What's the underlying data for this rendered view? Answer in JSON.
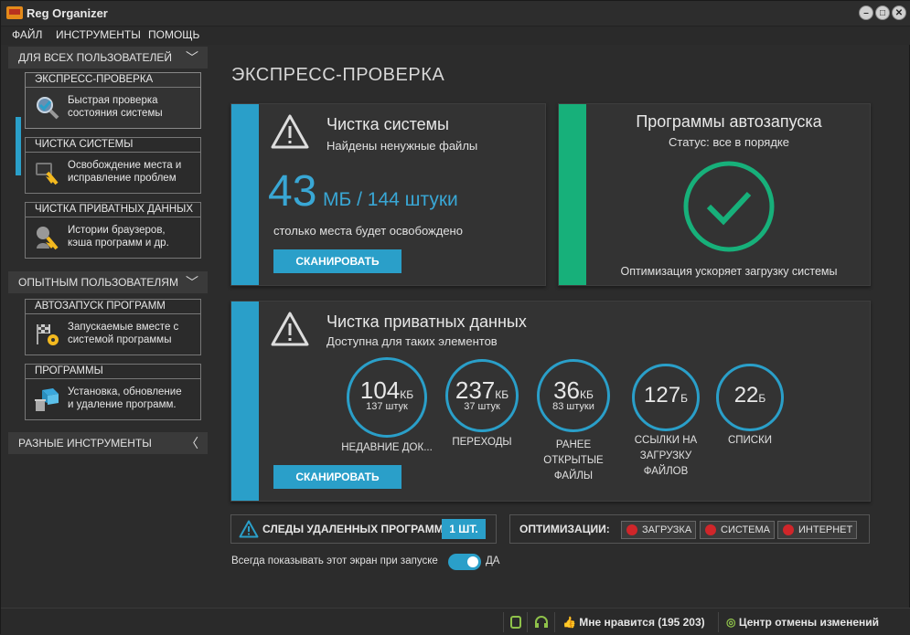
{
  "window": {
    "title": "Reg Organizer"
  },
  "menu": [
    "ФАЙЛ",
    "ИНСТРУМЕНТЫ",
    "ПОМОЩЬ"
  ],
  "sidebar": {
    "group1": "ДЛЯ ВСЕХ ПОЛЬЗОВАТЕЛЕЙ",
    "group2": "ОПЫТНЫМ ПОЛЬЗОВАТЕЛЯМ",
    "group3": "РАЗНЫЕ ИНСТРУМЕНТЫ",
    "items": [
      {
        "title": "ЭКСПРЕСС-ПРОВЕРКА",
        "desc1": "Быстрая проверка",
        "desc2": "состояния системы"
      },
      {
        "title": "ЧИСТКА СИСТЕМЫ",
        "desc1": "Освобождение места и",
        "desc2": "исправление проблем"
      },
      {
        "title": "ЧИСТКА ПРИВАТНЫХ ДАННЫХ",
        "desc1": "Истории браузеров,",
        "desc2": "кэша программ и др."
      },
      {
        "title": "АВТОЗАПУСК ПРОГРАММ",
        "desc1": "Запускаемые вместе с",
        "desc2": "системой программы"
      },
      {
        "title": "ПРОГРАММЫ",
        "desc1": "Установка, обновление",
        "desc2": "и удаление программ."
      }
    ]
  },
  "main": {
    "title": "ЭКСПРЕСС-ПРОВЕРКА",
    "system_clean": {
      "title": "Чистка системы",
      "subtitle": "Найдены ненужные файлы",
      "size": "43",
      "details": "МБ / 144 штуки",
      "caption": "столько места будет освобождено",
      "button": "СКАНИРОВАТЬ"
    },
    "autorun": {
      "title": "Программы автозапуска",
      "status": "Статус: все в порядке",
      "note": "Оптимизация ускоряет загрузку системы"
    },
    "private": {
      "title": "Чистка приватных данных",
      "subtitle": "Доступна для таких элементов",
      "button": "СКАНИРОВАТЬ",
      "items": [
        {
          "value": "104",
          "unit": "КБ",
          "sub": "137 штук",
          "label": "НЕДАВНИЕ ДОК..."
        },
        {
          "value": "237",
          "unit": "КБ",
          "sub": "37 штук",
          "label": "ПЕРЕХОДЫ"
        },
        {
          "value": "36",
          "unit": "КБ",
          "sub": "83 штуки",
          "label": "РАНЕЕ ОТКРЫТЫЕ ФАЙЛЫ"
        },
        {
          "value": "127",
          "unit": "Б",
          "sub": "",
          "label": "ССЫЛКИ НА ЗАГРУЗКУ ФАЙЛОВ"
        },
        {
          "value": "22",
          "unit": "Б",
          "sub": "",
          "label": "СПИСКИ"
        }
      ]
    },
    "traces": {
      "label": "СЛЕДЫ УДАЛЕННЫХ ПРОГРАММ",
      "count": "1 ШТ."
    },
    "optim": {
      "label": "ОПТИМИЗАЦИИ:",
      "b1": "ЗАГРУЗКА",
      "b2": "СИСТЕМА",
      "b3": "ИНТЕРНЕТ"
    },
    "toggle": {
      "label": "Всегда показывать этот экран при запуске",
      "value": "ДА"
    }
  },
  "status": {
    "likes": "Мне нравится (195 203)",
    "undo": "Центр отмены изменений"
  },
  "colors": {
    "accent": "#2a9fc9",
    "success": "#17b07a",
    "danger": "#d0262a"
  }
}
